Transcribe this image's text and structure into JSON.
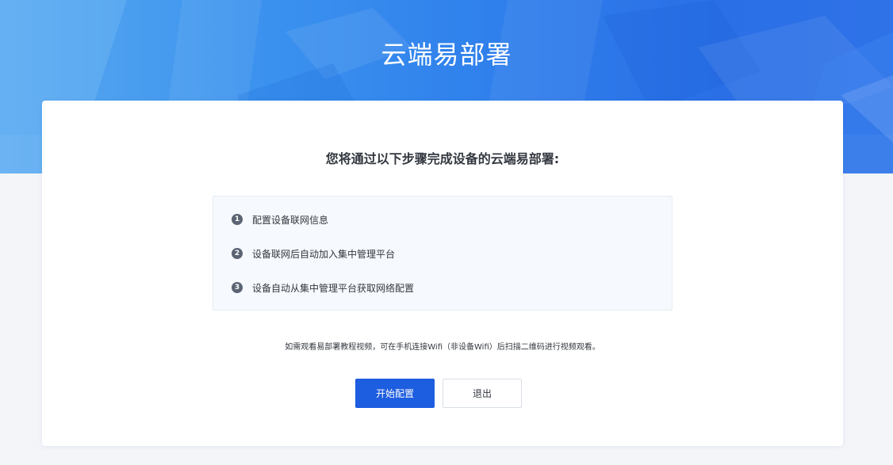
{
  "banner": {
    "title": "云端易部署"
  },
  "card": {
    "heading": "您将通过以下步骤完成设备的云端易部署:",
    "steps": [
      {
        "number": "1",
        "text": "配置设备联网信息"
      },
      {
        "number": "2",
        "text": "设备联网后自动加入集中管理平台"
      },
      {
        "number": "3",
        "text": "设备自动从集中管理平台获取网络配置"
      }
    ],
    "note": "如需观看易部署教程视频，可在手机连接Wifi（非设备Wifi）后扫描二维码进行视频观看。",
    "buttons": {
      "start_label": "开始配置",
      "exit_label": "退出"
    }
  },
  "colors": {
    "primary": "#1d5ddf",
    "banner_blue": "#2f80ec",
    "step_badge": "#5b6473"
  }
}
